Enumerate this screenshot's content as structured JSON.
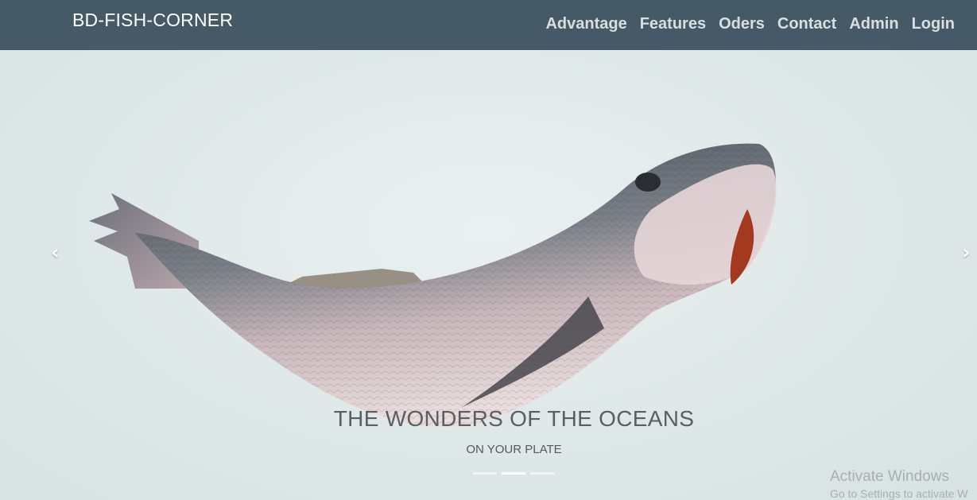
{
  "navbar": {
    "brand": "BD-FISH-CORNER",
    "links": [
      "Advantage",
      "Features",
      "Oders",
      "Contact",
      "Admin",
      "Login"
    ],
    "background": "#455a66"
  },
  "carousel": {
    "caption_title": "THE WONDERS OF THE OCEANS",
    "caption_subtitle": "ON YOUR PLATE",
    "prev_icon": "chevron-left-icon",
    "next_icon": "chevron-right-icon",
    "slide_count": 3,
    "active_slide": 2
  },
  "watermark": {
    "title": "Activate Windows",
    "subtitle": "Go to Settings to activate W"
  }
}
